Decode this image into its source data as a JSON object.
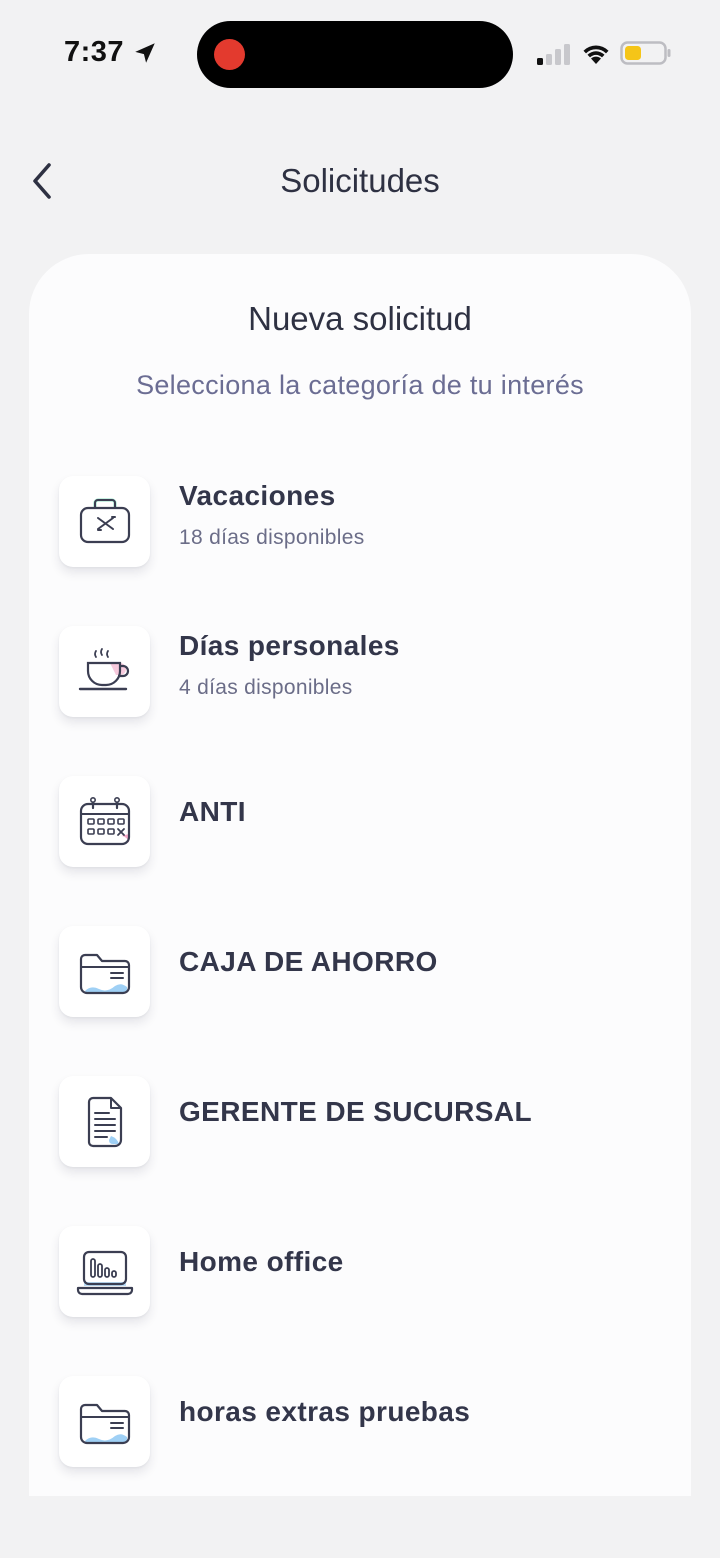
{
  "status_bar": {
    "time": "7:37",
    "icons": [
      "location-arrow-icon",
      "record-dot-icon",
      "cellular-signal-icon",
      "wifi-icon",
      "battery-icon"
    ],
    "record_color": "#e33a2e",
    "battery_color": "#f5c518"
  },
  "nav": {
    "back_icon": "chevron-left-icon",
    "title": "Solicitudes"
  },
  "card": {
    "title": "Nueva solicitud",
    "subtitle": "Selecciona la categoría de tu interés"
  },
  "categories": [
    {
      "name": "Vacaciones",
      "detail": "18 días disponibles",
      "icon": "suitcase-plane-icon"
    },
    {
      "name": "Días personales",
      "detail": "4 días disponibles",
      "icon": "coffee-cup-icon"
    },
    {
      "name": "ANTI",
      "detail": "",
      "icon": "calendar-icon"
    },
    {
      "name": "CAJA DE AHORRO",
      "detail": "",
      "icon": "folder-icon"
    },
    {
      "name": "GERENTE DE SUCURSAL",
      "detail": "",
      "icon": "document-icon"
    },
    {
      "name": "Home office",
      "detail": "",
      "icon": "laptop-chart-icon"
    },
    {
      "name": "horas extras pruebas",
      "detail": "",
      "icon": "folder-icon"
    }
  ],
  "colors": {
    "text_primary": "#2e3142",
    "text_secondary": "#6b6d93",
    "icon_accent_blue": "#9fd0f5",
    "icon_accent_pink": "#f2a7c6",
    "icon_accent_green": "#8fe0c3"
  }
}
